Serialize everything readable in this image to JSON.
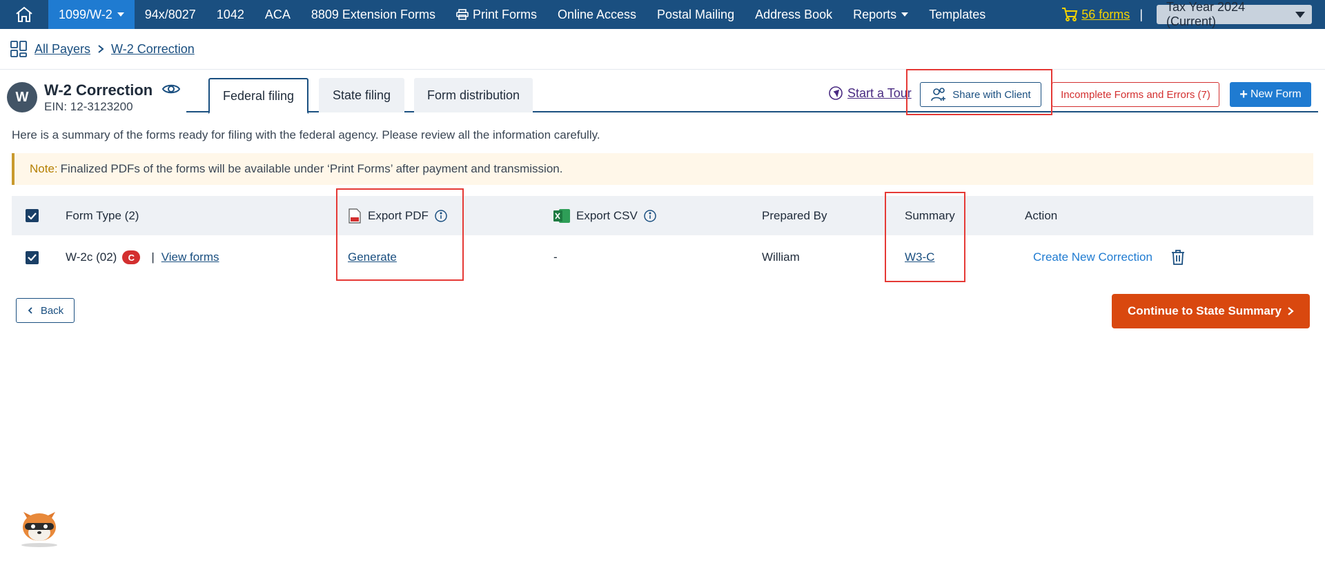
{
  "topnav": {
    "items": [
      "1099/W-2",
      "94x/8027",
      "1042",
      "ACA",
      "8809 Extension Forms",
      "Print Forms",
      "Online Access",
      "Postal Mailing",
      "Address Book",
      "Reports",
      "Templates"
    ],
    "cart_label": "56 forms",
    "separator": "|",
    "tax_year": "Tax Year 2024 (Current)"
  },
  "breadcrumb": {
    "root": "All Payers",
    "current": "W-2 Correction"
  },
  "payer": {
    "initial": "W",
    "name": "W-2 Correction",
    "ein": "EIN: 12-3123200"
  },
  "tabs": [
    "Federal filing",
    "State filing",
    "Form distribution"
  ],
  "actions": {
    "tour": "Start a Tour",
    "share": "Share with Client",
    "incomplete": "Incomplete Forms and Errors (7)",
    "new_form": "New Form"
  },
  "summary_text": "Here is a summary of the forms ready for filing with the federal agency. Please review all the information carefully.",
  "note": {
    "label": "Note:",
    "text": "Finalized PDFs of the forms will be available under ‘Print Forms’ after payment and transmission."
  },
  "table": {
    "headers": {
      "form_type": "Form Type  (2)",
      "export_pdf": "Export PDF",
      "export_csv": "Export CSV",
      "prepared_by": "Prepared By",
      "summary": "Summary",
      "action": "Action"
    },
    "row": {
      "form_type": "W-2c (02)",
      "badge": "C",
      "divider": "|",
      "view_forms": "View forms",
      "export_pdf": "Generate",
      "export_csv": "-",
      "prepared_by": "William",
      "summary": "W3-C",
      "action": "Create New Correction"
    }
  },
  "footer": {
    "back": "Back",
    "continue": "Continue to State Summary"
  },
  "colors": {
    "nav_bg": "#1a4f80",
    "active_tab": "#1f7bd1",
    "cart": "#f5d300",
    "continue": "#d9480f",
    "error": "#d32f2f",
    "highlight": "#e53935"
  }
}
